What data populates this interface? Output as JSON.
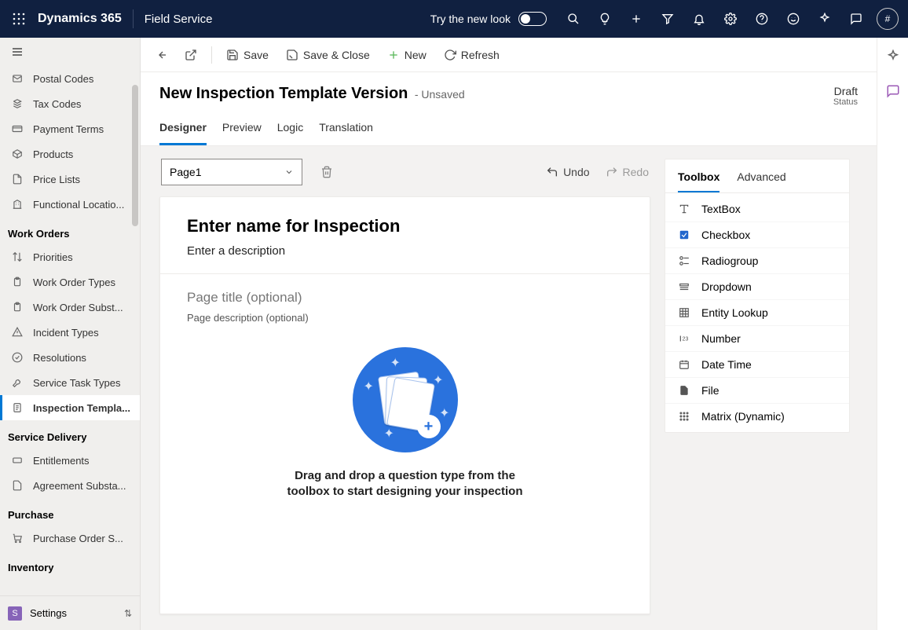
{
  "topbar": {
    "brand": "Dynamics 365",
    "app": "Field Service",
    "try_new": "Try the new look",
    "avatar_initial": "#"
  },
  "sidebar": {
    "items_top": [
      {
        "label": "Postal Codes"
      },
      {
        "label": "Tax Codes"
      },
      {
        "label": "Payment Terms"
      },
      {
        "label": "Products"
      },
      {
        "label": "Price Lists"
      },
      {
        "label": "Functional Locatio..."
      }
    ],
    "group_work_orders": "Work Orders",
    "items_work_orders": [
      {
        "label": "Priorities"
      },
      {
        "label": "Work Order Types"
      },
      {
        "label": "Work Order Subst..."
      },
      {
        "label": "Incident Types"
      },
      {
        "label": "Resolutions"
      },
      {
        "label": "Service Task Types"
      },
      {
        "label": "Inspection Templa...",
        "selected": true
      }
    ],
    "group_service_delivery": "Service Delivery",
    "items_service_delivery": [
      {
        "label": "Entitlements"
      },
      {
        "label": "Agreement Substa..."
      }
    ],
    "group_purchase": "Purchase",
    "items_purchase": [
      {
        "label": "Purchase Order S..."
      }
    ],
    "group_inventory": "Inventory",
    "footer": {
      "badge": "S",
      "label": "Settings"
    }
  },
  "commands": {
    "save": "Save",
    "save_close": "Save & Close",
    "new": "New",
    "refresh": "Refresh"
  },
  "record": {
    "title": "New Inspection Template Version",
    "unsaved": "- Unsaved",
    "status_value": "Draft",
    "status_label": "Status"
  },
  "tabs": [
    "Designer",
    "Preview",
    "Logic",
    "Translation"
  ],
  "designer": {
    "page_selector": "Page1",
    "undo": "Undo",
    "redo": "Redo",
    "name_placeholder": "Enter name for Inspection",
    "desc_placeholder": "Enter a description",
    "page_title_placeholder": "Page title (optional)",
    "page_desc_placeholder": "Page description (optional)",
    "dropzone_text": "Drag and drop a question type from the toolbox to start designing your inspection"
  },
  "toolbox": {
    "tabs": [
      "Toolbox",
      "Advanced"
    ],
    "items": [
      "TextBox",
      "Checkbox",
      "Radiogroup",
      "Dropdown",
      "Entity Lookup",
      "Number",
      "Date Time",
      "File",
      "Matrix (Dynamic)"
    ]
  }
}
